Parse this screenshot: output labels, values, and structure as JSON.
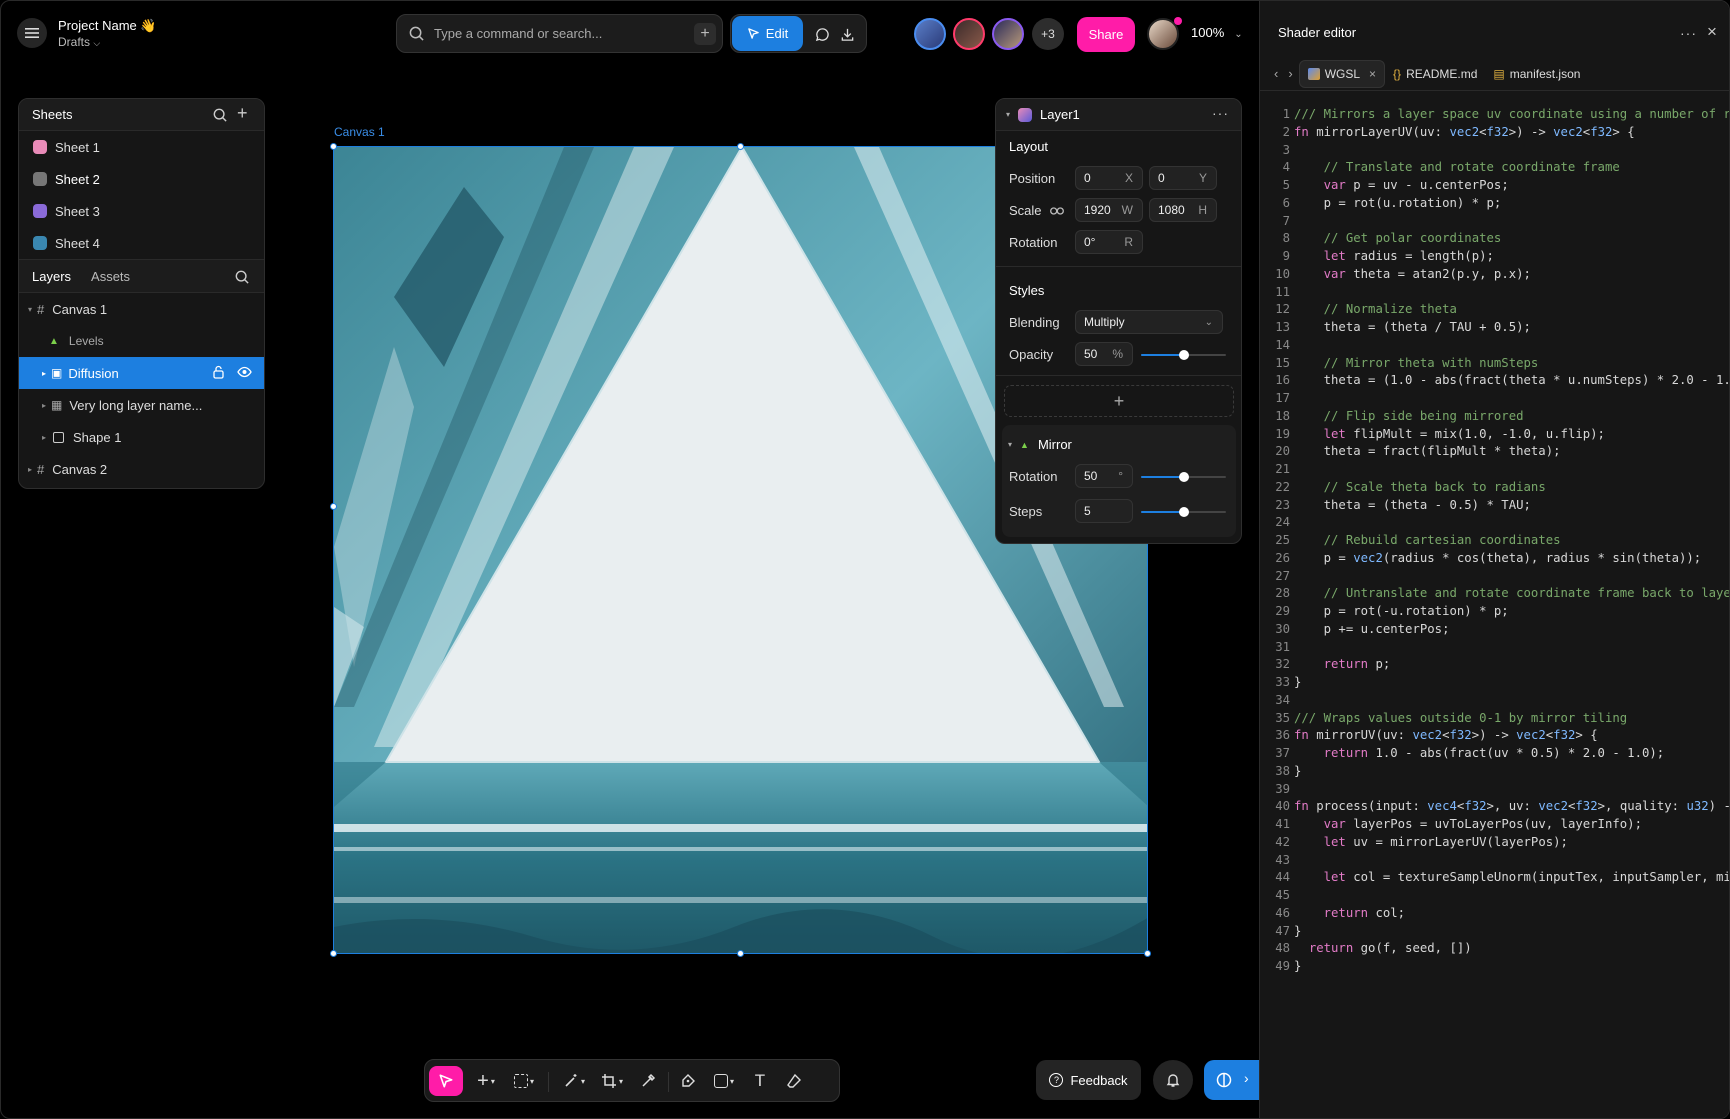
{
  "project": {
    "name": "Project Name 👋",
    "location": "Drafts"
  },
  "search": {
    "placeholder": "Type a command or search..."
  },
  "toolbar_top": {
    "edit_label": "Edit",
    "extra_users": "+3",
    "share_label": "Share",
    "zoom": "100%"
  },
  "sheets": {
    "title": "Sheets",
    "items": [
      {
        "label": "Sheet 1",
        "color": "#e98bb8"
      },
      {
        "label": "Sheet 2",
        "color": "#777777"
      },
      {
        "label": "Sheet 3",
        "color": "#8a6ad8"
      },
      {
        "label": "Sheet 4",
        "color": "#3a87b0"
      }
    ]
  },
  "layers_tabs": {
    "layers": "Layers",
    "assets": "Assets"
  },
  "layers": [
    {
      "label": "Canvas 1",
      "icon": "frame-icon"
    },
    {
      "label": "Levels",
      "icon": "levels-icon"
    },
    {
      "label": "Diffusion",
      "icon": "effect-icon"
    },
    {
      "label": "Very long layer name...",
      "icon": "image-icon"
    },
    {
      "label": "Shape 1",
      "icon": "rectangle-icon"
    },
    {
      "label": "Canvas 2",
      "icon": "frame-icon"
    }
  ],
  "canvas": {
    "label": "Canvas 1"
  },
  "layer_panel": {
    "title": "Layer1",
    "layout_title": "Layout",
    "position_label": "Position",
    "pos_x": "0",
    "pos_x_suffix": "X",
    "pos_y": "0",
    "pos_y_suffix": "Y",
    "scale_label": "Scale",
    "scale_w": "1920",
    "scale_w_suffix": "W",
    "scale_h": "1080",
    "scale_h_suffix": "H",
    "rotation_label": "Rotation",
    "rotation": "0°",
    "rotation_suffix": "R",
    "styles_title": "Styles",
    "blending_label": "Blending",
    "blending": "Multiply",
    "opacity_label": "Opacity",
    "opacity": "50",
    "opacity_suffix": "%",
    "opacity_level": 0.5,
    "effect_title": "Mirror",
    "mirror_rotation_label": "Rotation",
    "mirror_rotation": "50",
    "mirror_rotation_suffix": "°",
    "mirror_rotation_level": 0.5,
    "steps_label": "Steps",
    "steps": "5",
    "steps_level": 0.5
  },
  "bottom": {
    "feedback_label": "Feedback"
  },
  "editor": {
    "title": "Shader editor",
    "tabs": [
      "WGSL",
      "README.md",
      "manifest.json"
    ],
    "lines": [
      "/// Mirrors a layer space uv coordinate using a number of r",
      "fn mirrorLayerUV(uv: vec2<f32>) -> vec2<f32> {",
      "",
      "    // Translate and rotate coordinate frame",
      "    var p = uv - u.centerPos;",
      "    p = rot(u.rotation) * p;",
      "",
      "    // Get polar coordinates",
      "    let radius = length(p);",
      "    var theta = atan2(p.y, p.x);",
      "",
      "    // Normalize theta",
      "    theta = (theta / TAU + 0.5);",
      "",
      "    // Mirror theta with numSteps",
      "    theta = (1.0 - abs(fract(theta * u.numSteps) * 2.0 - 1.",
      "",
      "    // Flip side being mirrored",
      "    let flipMult = mix(1.0, -1.0, u.flip);",
      "    theta = fract(flipMult * theta);",
      "",
      "    // Scale theta back to radians",
      "    theta = (theta - 0.5) * TAU;",
      "",
      "    // Rebuild cartesian coordinates",
      "    p = vec2(radius * cos(theta), radius * sin(theta));",
      "",
      "    // Untranslate and rotate coordinate frame back to laye",
      "    p = rot(-u.rotation) * p;",
      "    p += u.centerPos;",
      "",
      "    return p;",
      "}",
      "",
      "/// Wraps values outside 0-1 by mirror tiling",
      "fn mirrorUV(uv: vec2<f32>) -> vec2<f32> {",
      "    return 1.0 - abs(fract(uv * 0.5) * 2.0 - 1.0);",
      "}",
      "",
      "fn process(input: vec4<f32>, uv: vec2<f32>, quality: u32) -",
      "    var layerPos = uvToLayerPos(uv, layerInfo);",
      "    let uv = mirrorLayerUV(layerPos);",
      "",
      "    let col = textureSampleUnorm(inputTex, inputSampler, mi",
      "",
      "    return col;",
      "}",
      "  return go(f, seed, [])",
      "}"
    ]
  }
}
